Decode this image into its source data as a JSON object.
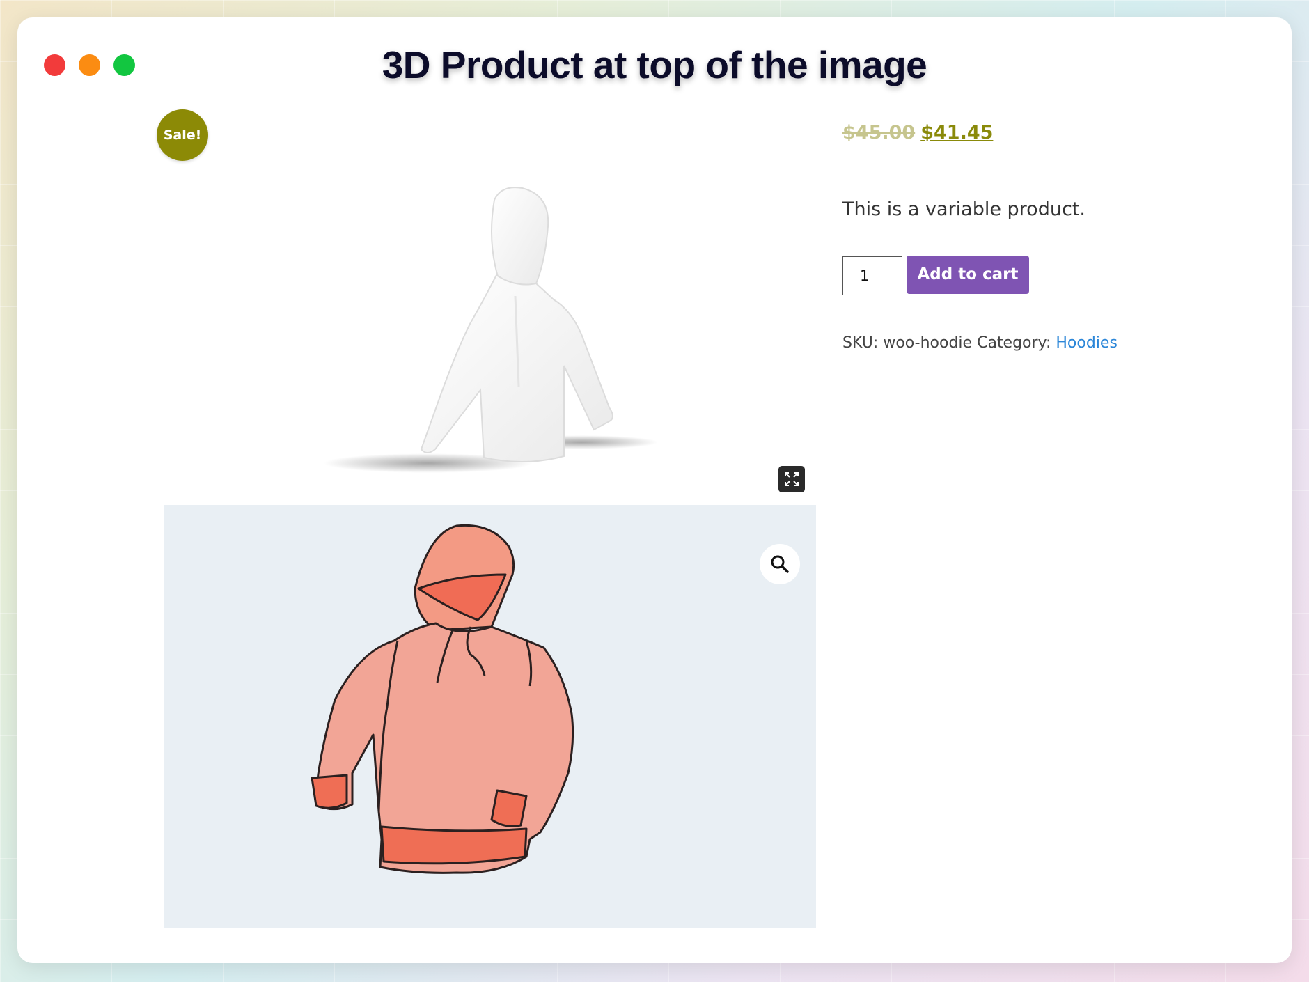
{
  "window": {
    "title": "3D Product at top of the image",
    "traffic_lights": [
      "#f23b3b",
      "#fb8c12",
      "#12c640"
    ]
  },
  "badge": {
    "label": "Sale!",
    "color": "#8c8a06"
  },
  "viewer": {
    "fullscreen_icon": "expand-arrows-icon",
    "model": "white-hoodie-3d"
  },
  "gallery": {
    "zoom_icon": "magnifier-icon",
    "image": "orange-hoodie-drawing"
  },
  "product": {
    "old_price": "$45.00",
    "price": "$41.45",
    "description": "This is a variable product.",
    "quantity": "1",
    "add_to_cart_label": "Add to cart",
    "sku_label": "SKU:",
    "sku": "woo-hoodie",
    "category_label": "Category:",
    "category": "Hoodies",
    "accent_color": "#7f54b3",
    "link_color": "#2b86d8"
  }
}
